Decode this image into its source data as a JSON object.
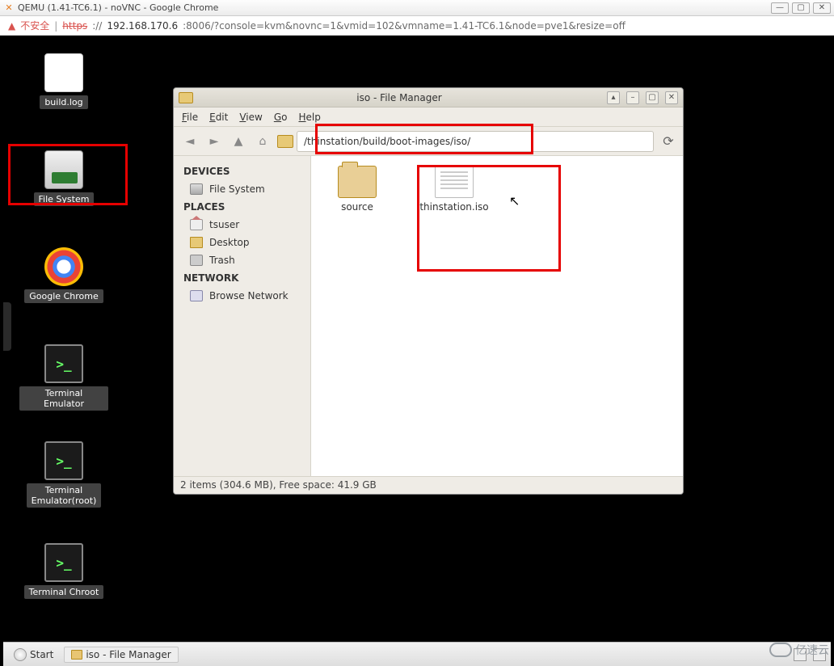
{
  "chrome": {
    "title": "QEMU (1.41-TC6.1) - noVNC - Google Chrome",
    "unsafe_label": "不安全",
    "https": "https",
    "sep": "://",
    "ip": "192.168.170.6",
    "port_path": ":8006/?console=kvm&novnc=1&vmid=102&vmname=1.41-TC6.1&node=pve1&resize=off"
  },
  "desktop": {
    "build_log": "build.log",
    "file_system": "File System",
    "google_chrome": "Google Chrome",
    "terminal_emulator": "Terminal Emulator",
    "terminal_emulator_root": "Terminal\nEmulator(root)",
    "terminal_chroot": "Terminal Chroot"
  },
  "panel": {
    "start": "Start",
    "task_label": "iso - File Manager"
  },
  "fm": {
    "title": "iso - File Manager",
    "menu": {
      "file": "File",
      "edit": "Edit",
      "view": "View",
      "go": "Go",
      "help": "Help"
    },
    "path": "/thinstation/build/boot-images/iso/",
    "side": {
      "devices": "DEVICES",
      "file_system": "File System",
      "places": "PLACES",
      "tsuser": "tsuser",
      "desktop": "Desktop",
      "trash": "Trash",
      "network": "NETWORK",
      "browse_network": "Browse Network"
    },
    "files": {
      "source": "source",
      "thinstation_iso": "thinstation.iso"
    },
    "status": "2 items (304.6 MB), Free space: 41.9 GB"
  },
  "watermark": "亿速云"
}
